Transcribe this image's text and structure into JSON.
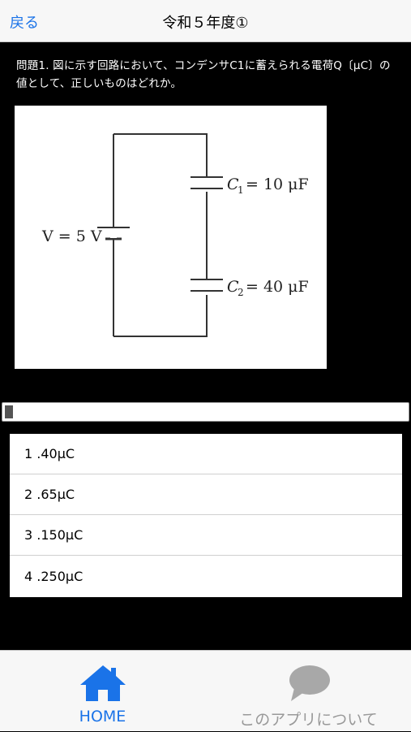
{
  "navbar": {
    "back_label": "戻る",
    "title": "令和５年度①"
  },
  "question": {
    "text": "問題1. 図に示す回路において、コンデンサC1に蓄えられる電荷Q〔μC〕の値として、正しいものはどれか。"
  },
  "figure": {
    "voltage_label": "V = 5 V",
    "c1_label": "= 10 μF",
    "c1_symbol": "C",
    "c1_sub": "1",
    "c2_label": "= 40 μF",
    "c2_symbol": "C",
    "c2_sub": "2"
  },
  "progress": {
    "fraction": 0.02
  },
  "answers": [
    {
      "label": "1 .40μC"
    },
    {
      "label": "2 .65μC"
    },
    {
      "label": "3 .150μC"
    },
    {
      "label": "4 .250μC"
    }
  ],
  "tabbar": {
    "home_label": "HOME",
    "home_icon": "home-icon",
    "about_label": "このアプリについて",
    "about_icon": "speech-bubble-icon",
    "active_color": "#1a73e8",
    "inactive_color": "#999999"
  }
}
